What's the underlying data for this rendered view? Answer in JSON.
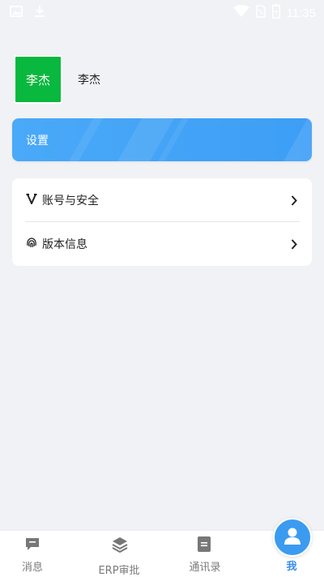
{
  "status_bar": {
    "time": "11:35",
    "icons": [
      "image-icon",
      "download-icon",
      "wifi-icon",
      "sim-icon",
      "battery-icon"
    ]
  },
  "profile": {
    "avatar_text": "李杰",
    "name": "李杰",
    "avatar_color": "#09b83e"
  },
  "banner": {
    "title": "设置",
    "color": "#4aa9f8"
  },
  "menu": {
    "items": [
      {
        "label": "账号与安全",
        "icon": "v-icon"
      },
      {
        "label": "版本信息",
        "icon": "fingerprint-icon"
      }
    ]
  },
  "bottom_nav": {
    "items": [
      {
        "label": "消息",
        "icon": "message-icon"
      },
      {
        "label": "ERP审批",
        "icon": "layers-icon"
      },
      {
        "label": "通讯录",
        "icon": "contacts-icon"
      },
      {
        "label": "我",
        "icon": "user-icon",
        "active": true
      }
    ],
    "active_color": "#3b8ef0",
    "inactive_color": "#7a7a7a"
  }
}
